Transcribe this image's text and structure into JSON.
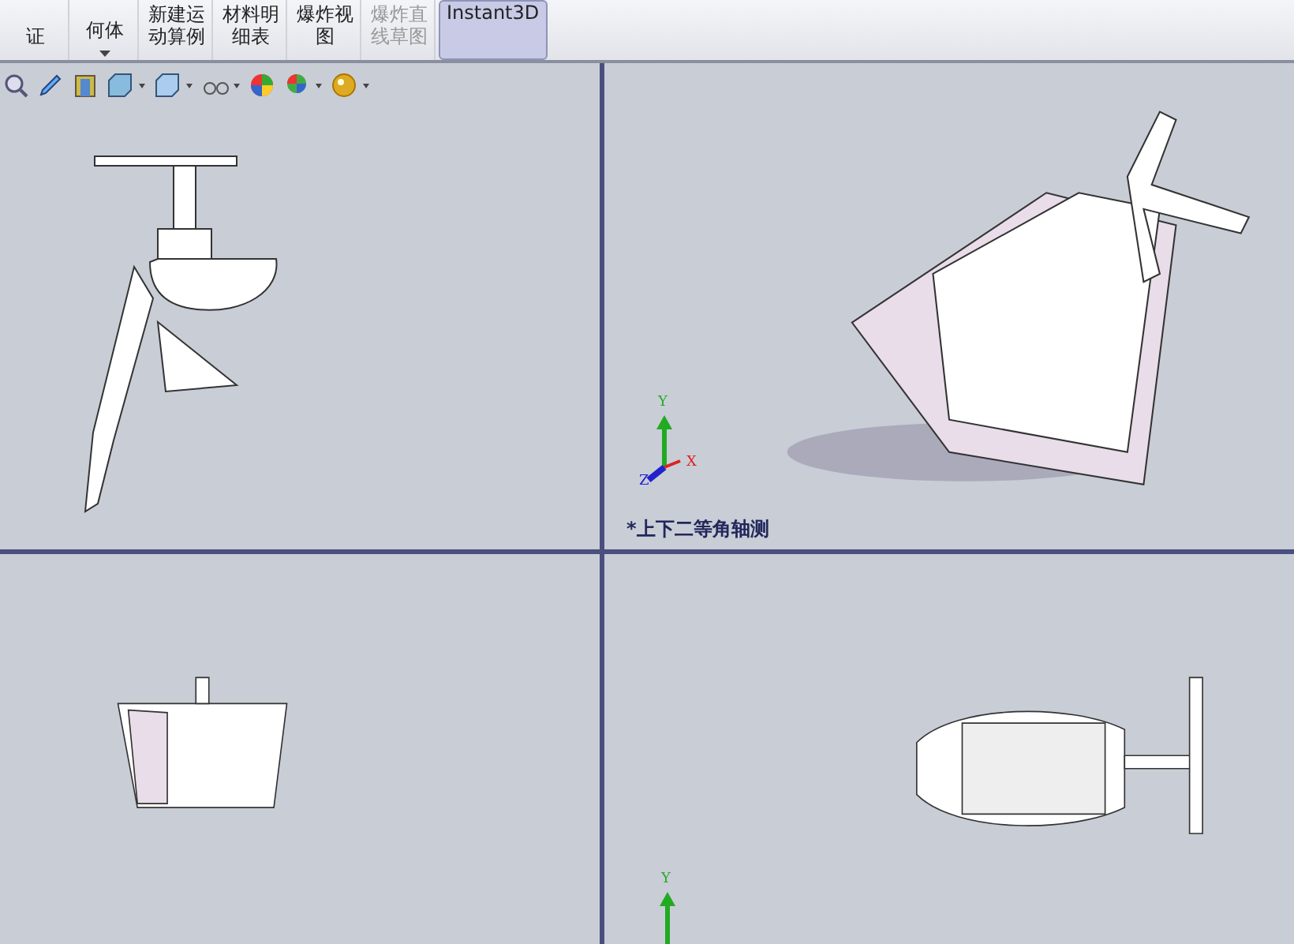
{
  "ribbon": {
    "buttons": [
      {
        "lines": [
          "证"
        ],
        "has_menu": false,
        "disabled": false,
        "selected": false
      },
      {
        "lines": [
          "何体"
        ],
        "has_menu": true,
        "disabled": false,
        "selected": false
      },
      {
        "lines": [
          "新建运",
          "动算例"
        ],
        "has_menu": false,
        "disabled": false,
        "selected": false
      },
      {
        "lines": [
          "材料明",
          "细表"
        ],
        "has_menu": false,
        "disabled": false,
        "selected": false
      },
      {
        "lines": [
          "爆炸视",
          "图"
        ],
        "has_menu": false,
        "disabled": false,
        "selected": false
      },
      {
        "lines": [
          "爆炸直",
          "线草图"
        ],
        "has_menu": false,
        "disabled": true,
        "selected": false
      },
      {
        "lines": [
          "Instant3D"
        ],
        "has_menu": false,
        "disabled": false,
        "selected": true
      }
    ]
  },
  "viewports": [
    {
      "kind": "side"
    },
    {
      "kind": "iso",
      "label": "*上下二等角轴测",
      "triad": {
        "y": "Y",
        "x": "X",
        "z": "Z"
      }
    },
    {
      "kind": "front"
    },
    {
      "kind": "top",
      "triad": {
        "y": "Y"
      }
    }
  ]
}
